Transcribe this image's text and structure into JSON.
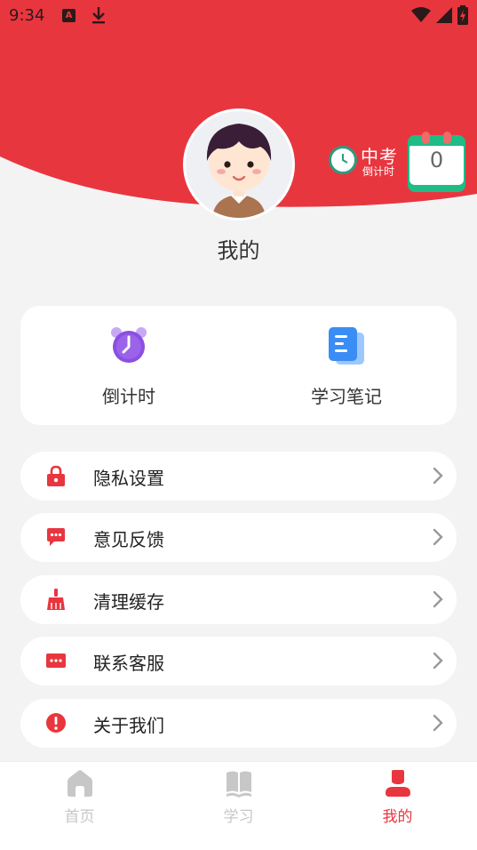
{
  "status_bar": {
    "time": "9:34",
    "a_badge": "A"
  },
  "profile": {
    "name": "我的"
  },
  "countdown_badge": {
    "title": "中考",
    "subtitle": "倒计时",
    "days": "0"
  },
  "quick_actions": [
    {
      "label": "倒计时",
      "icon": "alarm-clock-icon"
    },
    {
      "label": "学习笔记",
      "icon": "notes-icon"
    }
  ],
  "menu": [
    {
      "label": "隐私设置",
      "icon": "lock-icon"
    },
    {
      "label": "意见反馈",
      "icon": "feedback-icon"
    },
    {
      "label": "清理缓存",
      "icon": "broom-icon"
    },
    {
      "label": "联系客服",
      "icon": "chat-icon"
    },
    {
      "label": "关于我们",
      "icon": "info-icon"
    }
  ],
  "bottom_nav": [
    {
      "label": "首页",
      "icon": "home-icon",
      "active": false
    },
    {
      "label": "学习",
      "icon": "book-icon",
      "active": false
    },
    {
      "label": "我的",
      "icon": "user-icon",
      "active": true
    }
  ],
  "colors": {
    "brand_red": "#e8363f",
    "accent_green": "#1fbc86",
    "inactive_gray": "#c7c7c7"
  }
}
